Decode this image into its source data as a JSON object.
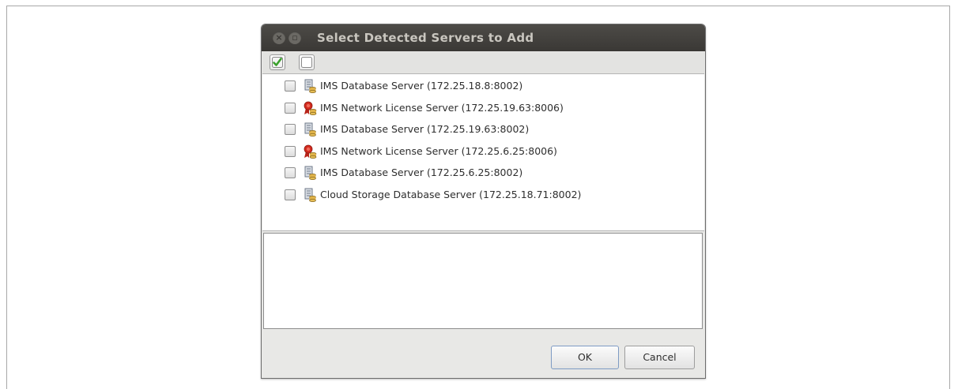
{
  "window": {
    "title": "Select Detected Servers to Add"
  },
  "toolbar": {
    "select_all_icon": "check-all-icon",
    "select_none_icon": "uncheck-all-icon"
  },
  "servers": [
    {
      "label": "IMS Database Server (172.25.18.8:8002)",
      "icon": "database-server-icon",
      "checked": false
    },
    {
      "label": "IMS Network License Server (172.25.19.63:8006)",
      "icon": "license-server-icon",
      "checked": false
    },
    {
      "label": "IMS Database Server (172.25.19.63:8002)",
      "icon": "database-server-icon",
      "checked": false
    },
    {
      "label": "IMS Network License Server (172.25.6.25:8006)",
      "icon": "license-server-icon",
      "checked": false
    },
    {
      "label": "IMS Database Server (172.25.6.25:8002)",
      "icon": "database-server-icon",
      "checked": false
    },
    {
      "label": "Cloud Storage Database Server (172.25.18.71:8002)",
      "icon": "database-server-icon",
      "checked": false
    }
  ],
  "buttons": {
    "ok": "OK",
    "cancel": "Cancel"
  },
  "colors": {
    "titlebar": "#3d3b38",
    "title_text": "#c9c6bf",
    "accent_green": "#3aa02c",
    "license_red": "#d32a1e"
  }
}
